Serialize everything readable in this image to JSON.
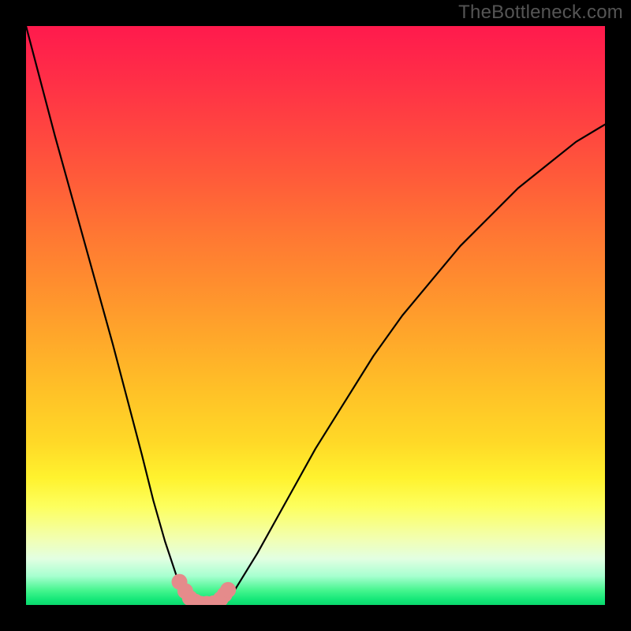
{
  "watermark": "TheBottleneck.com",
  "chart_data": {
    "type": "line",
    "title": "",
    "xlabel": "",
    "ylabel": "",
    "xlim": [
      0,
      100
    ],
    "ylim": [
      0,
      100
    ],
    "series": [
      {
        "name": "curve",
        "x": [
          0,
          5,
          10,
          15,
          20,
          22,
          24,
          26,
          27,
          28,
          29,
          30,
          31,
          32,
          33,
          34.5,
          36,
          40,
          45,
          50,
          55,
          60,
          65,
          70,
          75,
          80,
          85,
          90,
          95,
          100
        ],
        "values": [
          100,
          81,
          63,
          45,
          26,
          18,
          11,
          5,
          3,
          1.2,
          0.4,
          0,
          0,
          0,
          0.3,
          1.0,
          2.5,
          9,
          18,
          27,
          35,
          43,
          50,
          56,
          62,
          67,
          72,
          76,
          80,
          83
        ]
      }
    ],
    "markers": {
      "name": "highlight-dots",
      "x": [
        26.5,
        27.5,
        28.3,
        29.2,
        30.2,
        31.2,
        32.4,
        33.6,
        34.3,
        34.9
      ],
      "y": [
        4.0,
        2.4,
        1.2,
        0.6,
        0.2,
        0.2,
        0.3,
        1.0,
        1.8,
        2.6
      ],
      "color": "#e58b8b",
      "radius": 10
    },
    "background": {
      "type": "vertical-gradient",
      "stops": [
        {
          "pos": 0.0,
          "color": "#ff1a4d"
        },
        {
          "pos": 0.5,
          "color": "#ff9a2c"
        },
        {
          "pos": 0.78,
          "color": "#fff22e"
        },
        {
          "pos": 0.92,
          "color": "#e2ffe2"
        },
        {
          "pos": 1.0,
          "color": "#0ad96d"
        }
      ]
    }
  }
}
